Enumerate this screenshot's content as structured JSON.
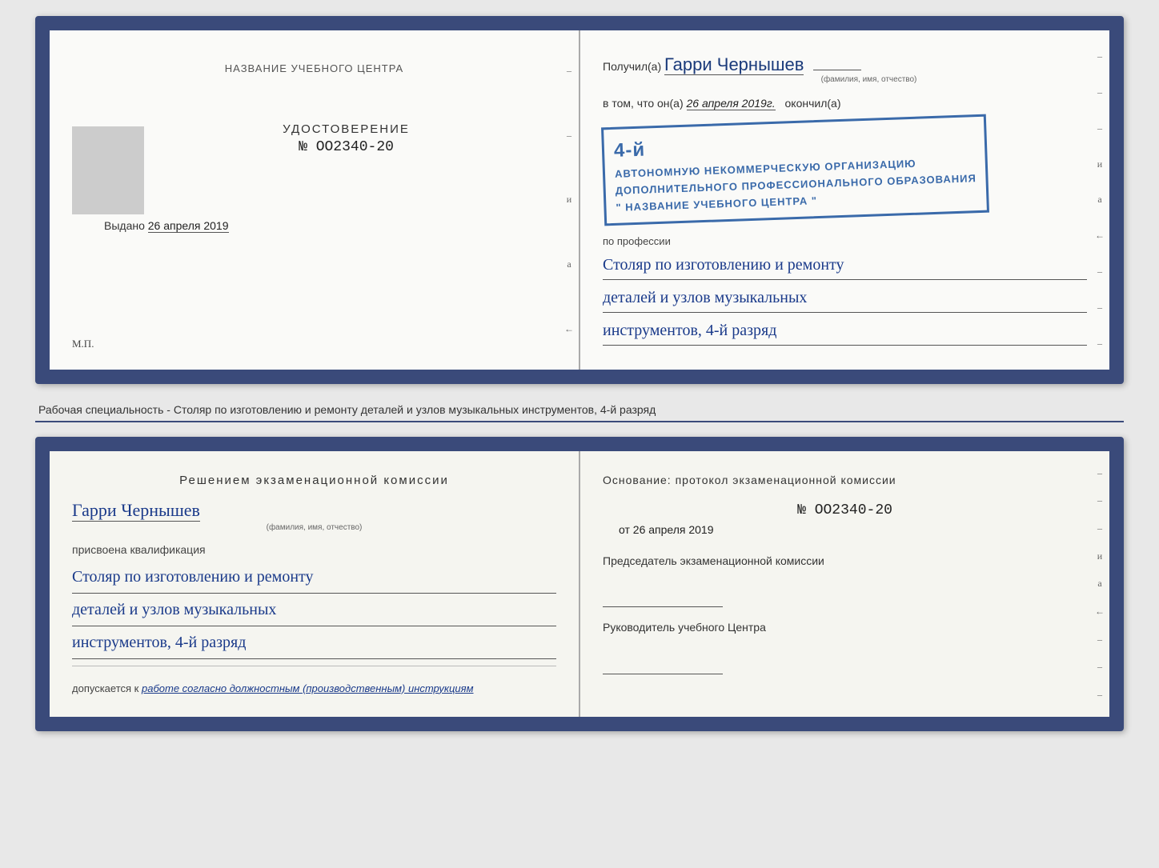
{
  "top_document": {
    "left_page": {
      "title": "НАЗВАНИЕ УЧЕБНОГО ЦЕНТРА",
      "photo_placeholder": "",
      "cert_label": "УДОСТОВЕРЕНИЕ",
      "cert_number_prefix": "№",
      "cert_number": "OO2340-20",
      "issued_label": "Выдано",
      "issued_date": "26 апреля 2019",
      "mp_label": "М.П."
    },
    "right_page": {
      "recipient_prefix": "Получил(а)",
      "recipient_name": "Гарри Чернышев",
      "fio_label": "(фамилия, имя, отчество)",
      "in_that_prefix": "в том, что он(а)",
      "completed_date": "26 апреля 2019г.",
      "completed_suffix": "окончил(а)",
      "stamp_line1": "4-й",
      "stamp_line2": "АВТОНОМНУЮ НЕКОММЕРЧЕСКУЮ ОРГАНИЗАЦИЮ",
      "stamp_line3": "ДОПОЛНИТЕЛЬНОГО ПРОФЕССИОНАЛЬНОГО ОБРАЗОВАНИЯ",
      "stamp_line4": "\" НАЗВАНИЕ УЧЕБНОГО ЦЕНТРА \"",
      "profession_label": "по профессии",
      "profession_line1": "Столяр по изготовлению и ремонту",
      "profession_line2": "деталей и узлов музыкальных",
      "profession_line3": "инструментов, 4-й разряд"
    }
  },
  "subtitle": "Рабочая специальность - Столяр по изготовлению и ремонту деталей и узлов музыкальных инструментов, 4-й разряд",
  "bottom_document": {
    "left_page": {
      "decision_title": "Решением  экзаменационной  комиссии",
      "person_name": "Гарри Чернышев",
      "fio_label": "(фамилия, имя, отчество)",
      "qualification_label": "присвоена квалификация",
      "profession_line1": "Столяр по изготовлению и ремонту",
      "profession_line2": "деталей и узлов музыкальных",
      "profession_line3": "инструментов, 4-й разряд",
      "допускается_prefix": "допускается к",
      "допускается_value": "работе согласно должностным (производственным) инструкциям"
    },
    "right_page": {
      "basis_text": "Основание:  протокол  экзаменационной  комиссии",
      "number_prefix": "№",
      "number_value": "OO2340-20",
      "from_prefix": "от",
      "from_date": "26 апреля 2019",
      "chairman_title": "Председатель экзаменационной комиссии",
      "director_title": "Руководитель учебного Центра"
    }
  },
  "side_chars": {
    "char1": "и",
    "char2": "а",
    "char3": "←"
  }
}
